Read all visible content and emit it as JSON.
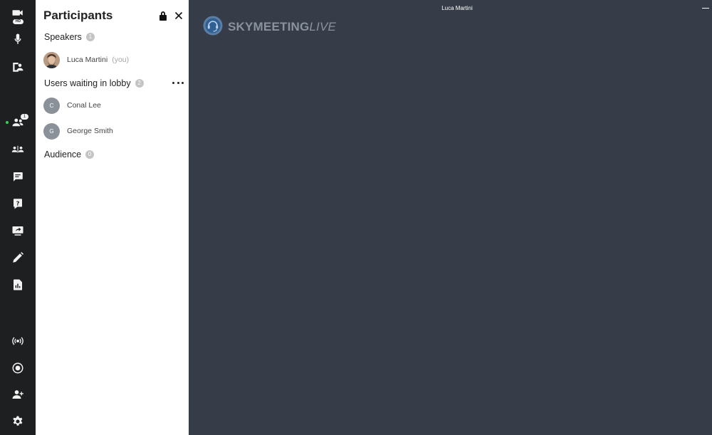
{
  "window": {
    "user_name": "Luca Martini"
  },
  "rail": {
    "hd_label": "HD",
    "participants_badge": "1",
    "items": [
      {
        "icon": "video-camera-icon"
      },
      {
        "icon": "microphone-icon"
      },
      {
        "icon": "contact-card-icon"
      },
      {
        "icon": "participants-icon"
      },
      {
        "icon": "breakout-rooms-icon"
      },
      {
        "icon": "chat-icon"
      },
      {
        "icon": "question-icon"
      },
      {
        "icon": "screen-share-icon"
      },
      {
        "icon": "pencil-icon"
      },
      {
        "icon": "report-icon"
      },
      {
        "icon": "broadcast-icon"
      },
      {
        "icon": "record-icon"
      },
      {
        "icon": "add-user-icon"
      },
      {
        "icon": "gear-icon"
      }
    ]
  },
  "panel": {
    "title": "Participants",
    "speakers": {
      "label": "Speakers",
      "count": "1",
      "items": [
        {
          "name": "Luca Martini",
          "suffix": "(you)"
        }
      ]
    },
    "lobby": {
      "label": "Users waiting in lobby",
      "count": "2",
      "items": [
        {
          "initial": "C",
          "name": "Conal Lee"
        },
        {
          "initial": "G",
          "name": "George Smith"
        }
      ]
    },
    "audience": {
      "label": "Audience",
      "count": "0"
    }
  },
  "logo": {
    "text_bold": "SKYMEETING",
    "text_light": "LIVE"
  },
  "colors": {
    "rail_bg": "#1e1f21",
    "stage_bg": "#373d48",
    "panel_bg": "#ffffff",
    "active_dot": "#39d353"
  }
}
